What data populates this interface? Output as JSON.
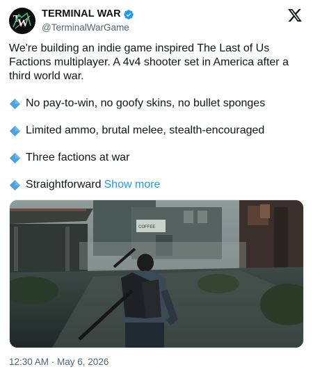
{
  "author": {
    "display_name": "TERMINAL WAR",
    "handle": "@TerminalWarGame",
    "avatar_icon": "terminal-war-logo",
    "verified_icon": "verified-badge-icon"
  },
  "platform_icon": "x-logo-icon",
  "tweet": {
    "intro": "We're building an indie game inspired The Last of Us Factions multiplayer. A 4v4 shooter set in America after a third world war.",
    "bullets": [
      "No pay-to-win, no goofy skins, no bullet sponges",
      "Limited ammo, brutal melee, stealth-encouraged",
      "Three factions at war",
      "Straightforward"
    ],
    "show_more": "Show more"
  },
  "media": {
    "description_icon": "game-screenshot-image",
    "signage_text": "COFFEE"
  },
  "timestamp": "12:30 AM · May 6, 2026",
  "colors": {
    "link": "#1d9bf0",
    "secondary_text": "#536471",
    "verified": "#1d9bf0",
    "bullet_diamond": "#4aa3df"
  }
}
